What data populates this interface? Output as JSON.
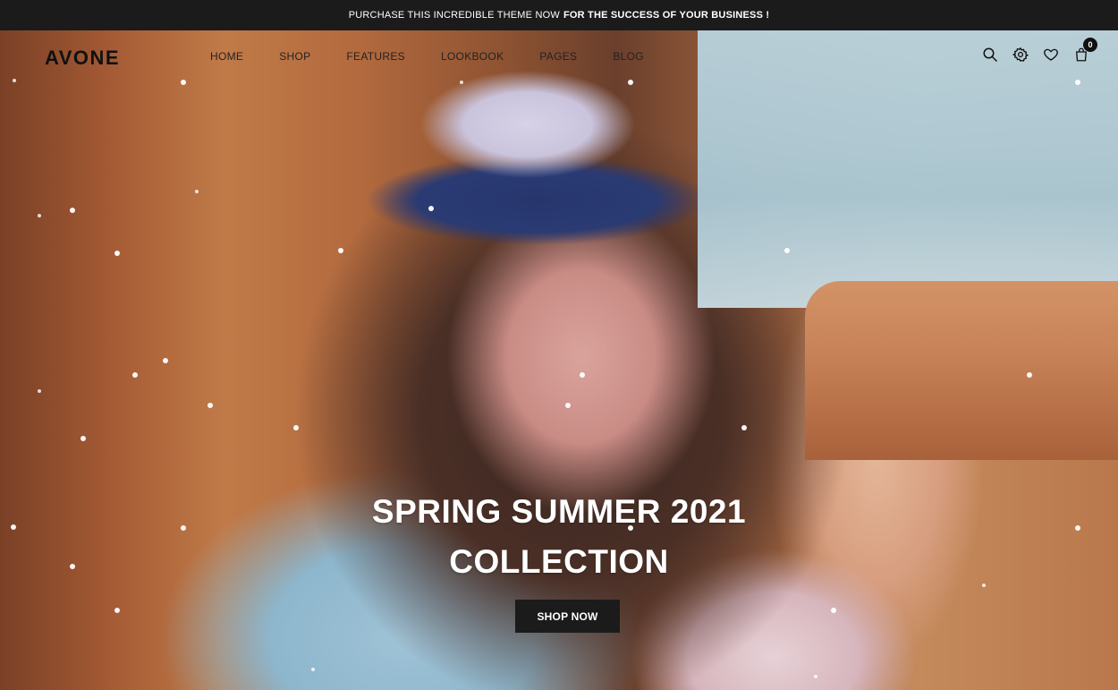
{
  "announcement": {
    "text": "PURCHASE THIS INCREDIBLE THEME NOW",
    "bold_text": "FOR THE SUCCESS OF YOUR BUSINESS !"
  },
  "header": {
    "logo": "AVONE",
    "nav": [
      "HOME",
      "SHOP",
      "FEATURES",
      "LOOKBOOK",
      "PAGES",
      "BLOG"
    ],
    "icons": [
      "search-icon",
      "settings-icon",
      "heart-icon",
      "cart-icon"
    ],
    "cart_count": "0"
  },
  "hero": {
    "title_line1": "SPRING SUMMER 2021",
    "title_line2": "COLLECTION",
    "button_label": "SHOP NOW"
  },
  "colors": {
    "dark": "#1b1b1b",
    "white": "#ffffff",
    "text": "#222222"
  }
}
